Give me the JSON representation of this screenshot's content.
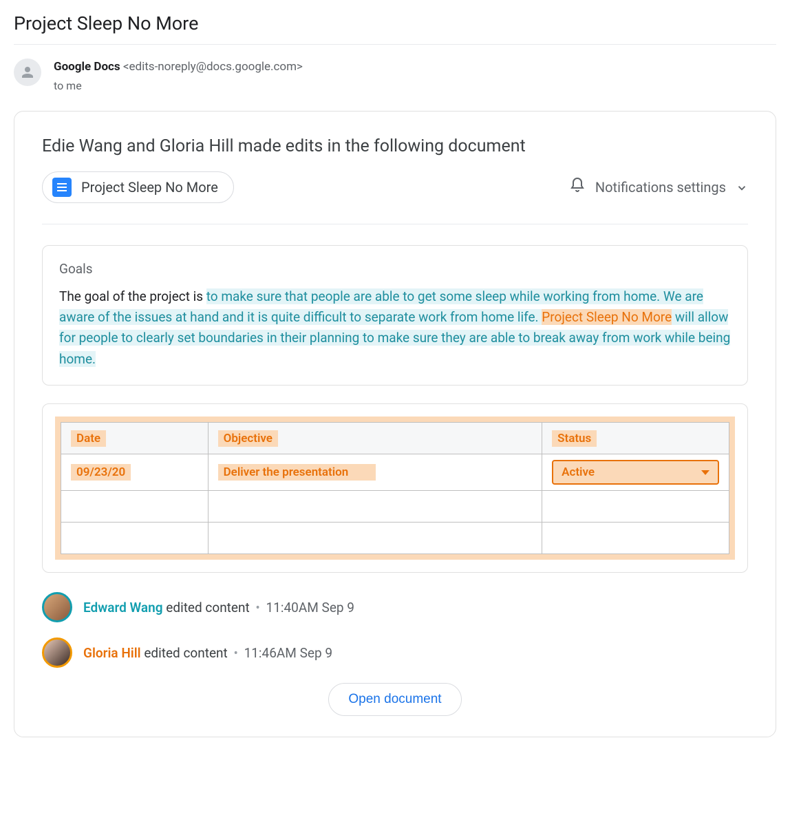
{
  "subject": "Project Sleep No More",
  "sender": {
    "name": "Google Docs",
    "email": "<edits-noreply@docs.google.com>",
    "to_line": "to me"
  },
  "summary": "Edie Wang and Gloria Hill made edits in the following document",
  "document": {
    "title": "Project Sleep No More"
  },
  "notifications_label": "Notifications settings",
  "goals": {
    "heading": "Goals",
    "prefix": "The goal of the project is ",
    "teal1": "to make sure that people are able to get some sleep while working from home. We are aware of the issues at hand and it is quite difficult to separate work from home life. ",
    "orange": "Project Sleep No More",
    "teal2": " will allow for people to clearly set boundaries in their planning to make sure they are able to break away from work while being home."
  },
  "table": {
    "headers": {
      "date": "Date",
      "objective": "Objective",
      "status": "Status"
    },
    "row": {
      "date": "09/23/20",
      "objective": "Deliver the presentation",
      "status": "Active"
    }
  },
  "edits": [
    {
      "name": "Edward Wang",
      "action": "edited content",
      "time": "11:40AM Sep 9",
      "color": "teal"
    },
    {
      "name": "Gloria Hill",
      "action": "edited content",
      "time": "11:46AM Sep 9",
      "color": "orange"
    }
  ],
  "open_button": "Open document"
}
